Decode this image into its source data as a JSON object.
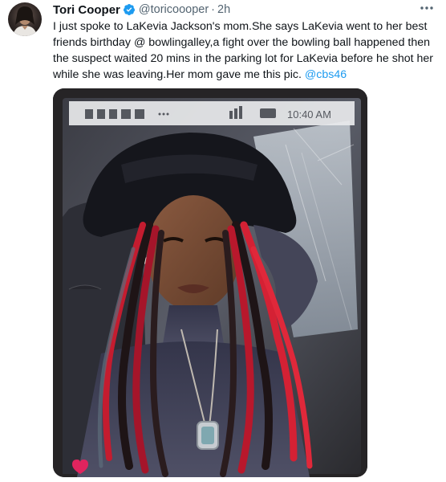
{
  "author": {
    "display_name": "Tori Cooper",
    "handle": "@toricoooper",
    "separator": "·",
    "time": "2h",
    "verified_icon": "verified-badge-icon",
    "verified_color": "#1d9bf0"
  },
  "tweet": {
    "text": "I just spoke to LaKevia Jackson's mom.She says LaKevia went to her best friends birthday @ bowlingalley,a fight over the bowling ball happened then the suspect waited 20 mins in the parking lot for LaKevia before he shot her while she was leaving.Her mom gave me this pic.",
    "mention": "@cbs46",
    "mention_color": "#1d9bf0"
  },
  "media": {
    "description_icon": "photo-of-printed-photo",
    "phone_status_time": "10:40 AM"
  },
  "more_icon": "more-horizontal-icon"
}
